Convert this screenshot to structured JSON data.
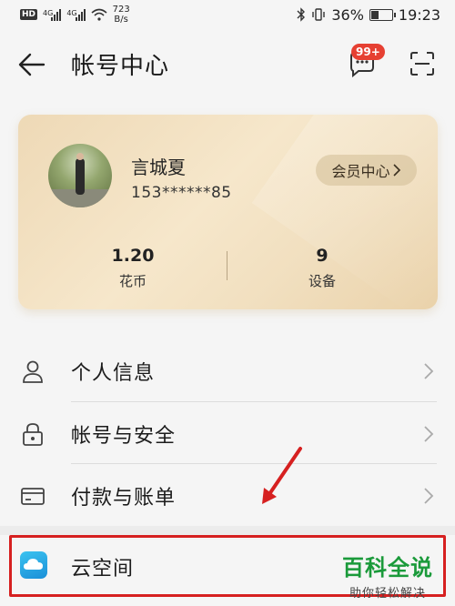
{
  "status_bar": {
    "hd": "HD",
    "signal_1": "4G",
    "signal_2": "4G",
    "speed_value": "723",
    "speed_unit": "B/s",
    "battery": "36%",
    "time": "19:23"
  },
  "header": {
    "title": "帐号中心",
    "message_badge": "99+"
  },
  "account": {
    "name": "言城夏",
    "phone": "153******85",
    "vip_label": "会员中心",
    "stats": [
      {
        "value": "1.20",
        "label": "花币"
      },
      {
        "value": "9",
        "label": "设备"
      }
    ]
  },
  "menu": {
    "items": [
      {
        "label": "个人信息",
        "icon": "person-icon"
      },
      {
        "label": "帐号与安全",
        "icon": "lock-icon"
      },
      {
        "label": "付款与账单",
        "icon": "card-icon"
      },
      {
        "label": "云空间",
        "icon": "cloud-icon"
      }
    ]
  },
  "watermark": {
    "main": "百科全说",
    "sub": "助你轻松解决"
  },
  "colors": {
    "highlight": "#d62020",
    "badge": "#e64032",
    "watermark": "#1a9a3a"
  }
}
